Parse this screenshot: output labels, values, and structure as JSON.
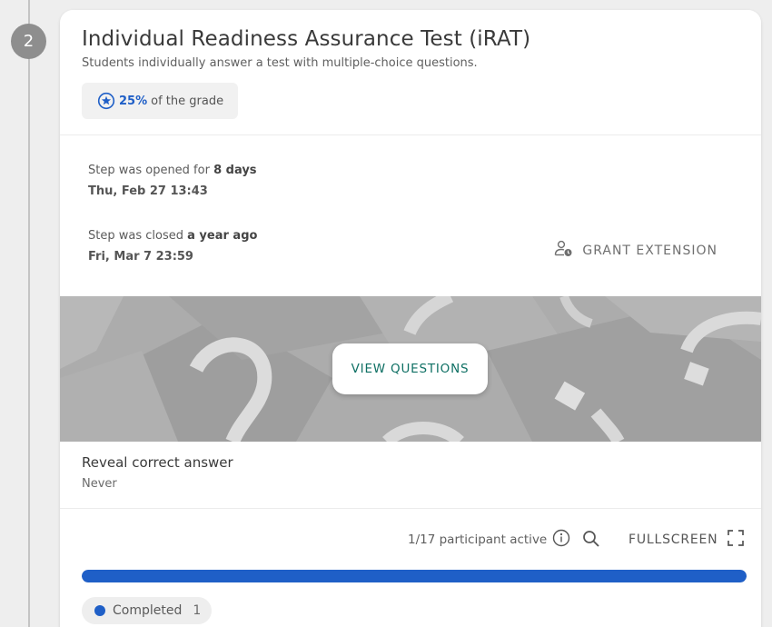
{
  "step": {
    "number": "2",
    "title": "Individual Readiness Assurance Test (iRAT)",
    "subtitle": "Students individually answer a test with multiple-choice questions.",
    "grade": {
      "percent": "25%",
      "suffix": "of the grade",
      "icon": "star-circle-icon"
    }
  },
  "dates": {
    "opened": {
      "prefix": "Step was opened for",
      "duration": "8 days",
      "date": "Thu, Feb 27 13:43"
    },
    "closed": {
      "prefix": "Step was closed",
      "duration": "a year ago",
      "date": "Fri, Mar 7 23:59"
    }
  },
  "grant_extension": {
    "label": "GRANT EXTENSION",
    "icon": "person-clock-icon"
  },
  "banner": {
    "button_label": "VIEW QUESTIONS"
  },
  "reveal": {
    "title": "Reveal correct answer",
    "value": "Never"
  },
  "toolbar": {
    "participants": "1/17 participant active",
    "info_icon": "info-icon",
    "search_icon": "search-icon",
    "fullscreen_label": "FULLSCREEN",
    "fullscreen_icon": "fullscreen-icon"
  },
  "progress": {
    "completed_fraction": 1.0
  },
  "legend": {
    "label": "Completed",
    "count": "1"
  },
  "colors": {
    "accent": "#1f5fc7",
    "teal": "#0f7064",
    "step_circle": "#8e8e8e"
  }
}
